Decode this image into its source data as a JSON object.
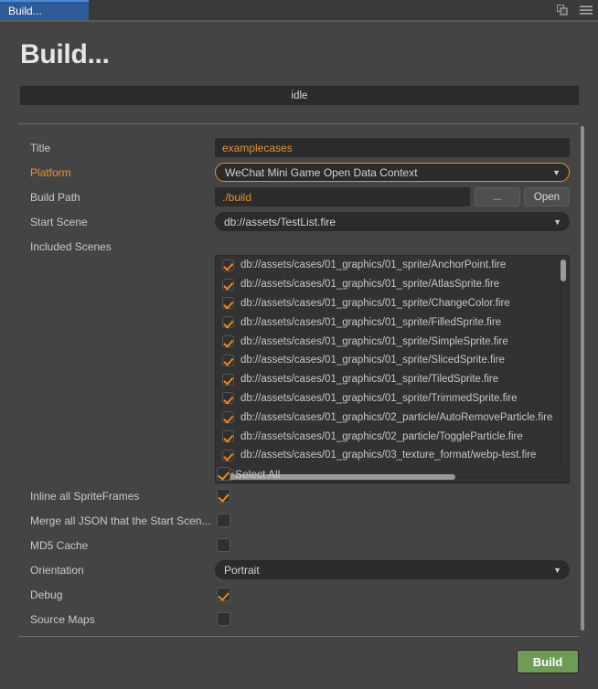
{
  "titlebar": {
    "tab_label": "Build...",
    "icons": [
      {
        "name": "restore-window-icon",
        "glyph": "❐"
      },
      {
        "name": "hamburger-menu-icon",
        "glyph": "≡"
      }
    ]
  },
  "page": {
    "title": "Build...",
    "status": "idle"
  },
  "form": {
    "title": {
      "label": "Title",
      "value": "examplecases"
    },
    "platform": {
      "label": "Platform",
      "value": "WeChat Mini Game Open Data Context",
      "modified": true
    },
    "build_path": {
      "label": "Build Path",
      "value": "./build",
      "browse_label": "...",
      "open_label": "Open"
    },
    "start_scene": {
      "label": "Start Scene",
      "value": "db://assets/TestList.fire"
    },
    "included_scenes": {
      "label": "Included Scenes"
    },
    "select_all": {
      "label": "Select All",
      "checked": true
    },
    "inline_spriteframes": {
      "label": "Inline all SpriteFrames",
      "checked": true
    },
    "merge_json": {
      "label": "Merge all JSON that the Start Scen...",
      "checked": false
    },
    "md5_cache": {
      "label": "MD5 Cache",
      "checked": false
    },
    "orientation": {
      "label": "Orientation",
      "value": "Portrait"
    },
    "debug": {
      "label": "Debug",
      "checked": true
    },
    "source_maps": {
      "label": "Source Maps",
      "checked": false
    }
  },
  "scenes": [
    {
      "path": "db://assets/cases/01_graphics/01_sprite/AnchorPoint.fire",
      "checked": true
    },
    {
      "path": "db://assets/cases/01_graphics/01_sprite/AtlasSprite.fire",
      "checked": true
    },
    {
      "path": "db://assets/cases/01_graphics/01_sprite/ChangeColor.fire",
      "checked": true
    },
    {
      "path": "db://assets/cases/01_graphics/01_sprite/FilledSprite.fire",
      "checked": true
    },
    {
      "path": "db://assets/cases/01_graphics/01_sprite/SimpleSprite.fire",
      "checked": true
    },
    {
      "path": "db://assets/cases/01_graphics/01_sprite/SlicedSprite.fire",
      "checked": true
    },
    {
      "path": "db://assets/cases/01_graphics/01_sprite/TiledSprite.fire",
      "checked": true
    },
    {
      "path": "db://assets/cases/01_graphics/01_sprite/TrimmedSprite.fire",
      "checked": true
    },
    {
      "path": "db://assets/cases/01_graphics/02_particle/AutoRemoveParticle.fire",
      "checked": true
    },
    {
      "path": "db://assets/cases/01_graphics/02_particle/ToggleParticle.fire",
      "checked": true
    },
    {
      "path": "db://assets/cases/01_graphics/03_texture_format/webp-test.fire",
      "checked": true
    }
  ],
  "footer": {
    "build_label": "Build"
  },
  "colors": {
    "accent_orange": "#e8922e",
    "tab_blue": "#2f5b99",
    "build_green": "#6f9c55",
    "panel_bg": "#444444",
    "field_bg": "#2b2b2b"
  }
}
